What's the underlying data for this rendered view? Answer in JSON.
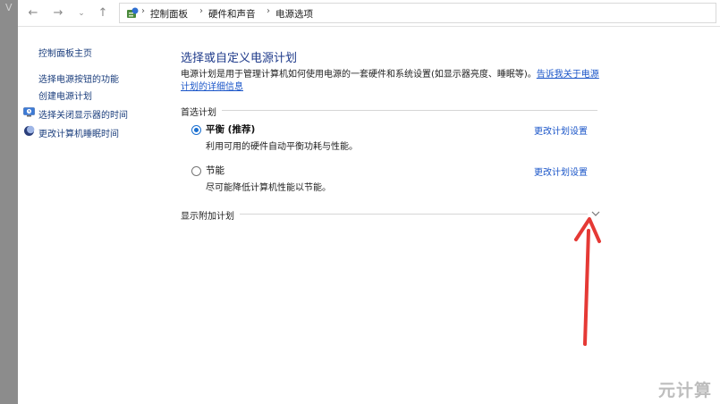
{
  "address_bar": {
    "back_icon": "arrow-left-icon",
    "forward_icon": "arrow-right-icon",
    "recent_icon": "chevron-down-icon",
    "up_icon": "arrow-up-icon",
    "breadcrumbs": [
      "控制面板",
      "硬件和声音",
      "电源选项"
    ]
  },
  "sidebar": {
    "items": [
      {
        "label": "控制面板主页"
      },
      {
        "label": "选择电源按钮的功能"
      },
      {
        "label": "创建电源计划"
      },
      {
        "label": "选择关闭显示器的时间",
        "icon": "monitor-clock-icon"
      },
      {
        "label": "更改计算机睡眠时间",
        "icon": "moon-icon"
      }
    ]
  },
  "main": {
    "title": "选择或自定义电源计划",
    "description": "电源计划是用于管理计算机如何使用电源的一套硬件和系统设置(如显示器亮度、睡眠等)。",
    "description_link": "告诉我关于电源计划的详细信息",
    "preferred_label": "首选计划",
    "plans": [
      {
        "name": "平衡 (推荐)",
        "desc": "利用可用的硬件自动平衡功耗与性能。",
        "link": "更改计划设置",
        "selected": true
      },
      {
        "name": "节能",
        "desc": "尽可能降低计算机性能以节能。",
        "link": "更改计划设置",
        "selected": false
      }
    ],
    "additional_label": "显示附加计划"
  },
  "annotation": {
    "arrow_color": "#e53935"
  },
  "watermark": "元计算"
}
